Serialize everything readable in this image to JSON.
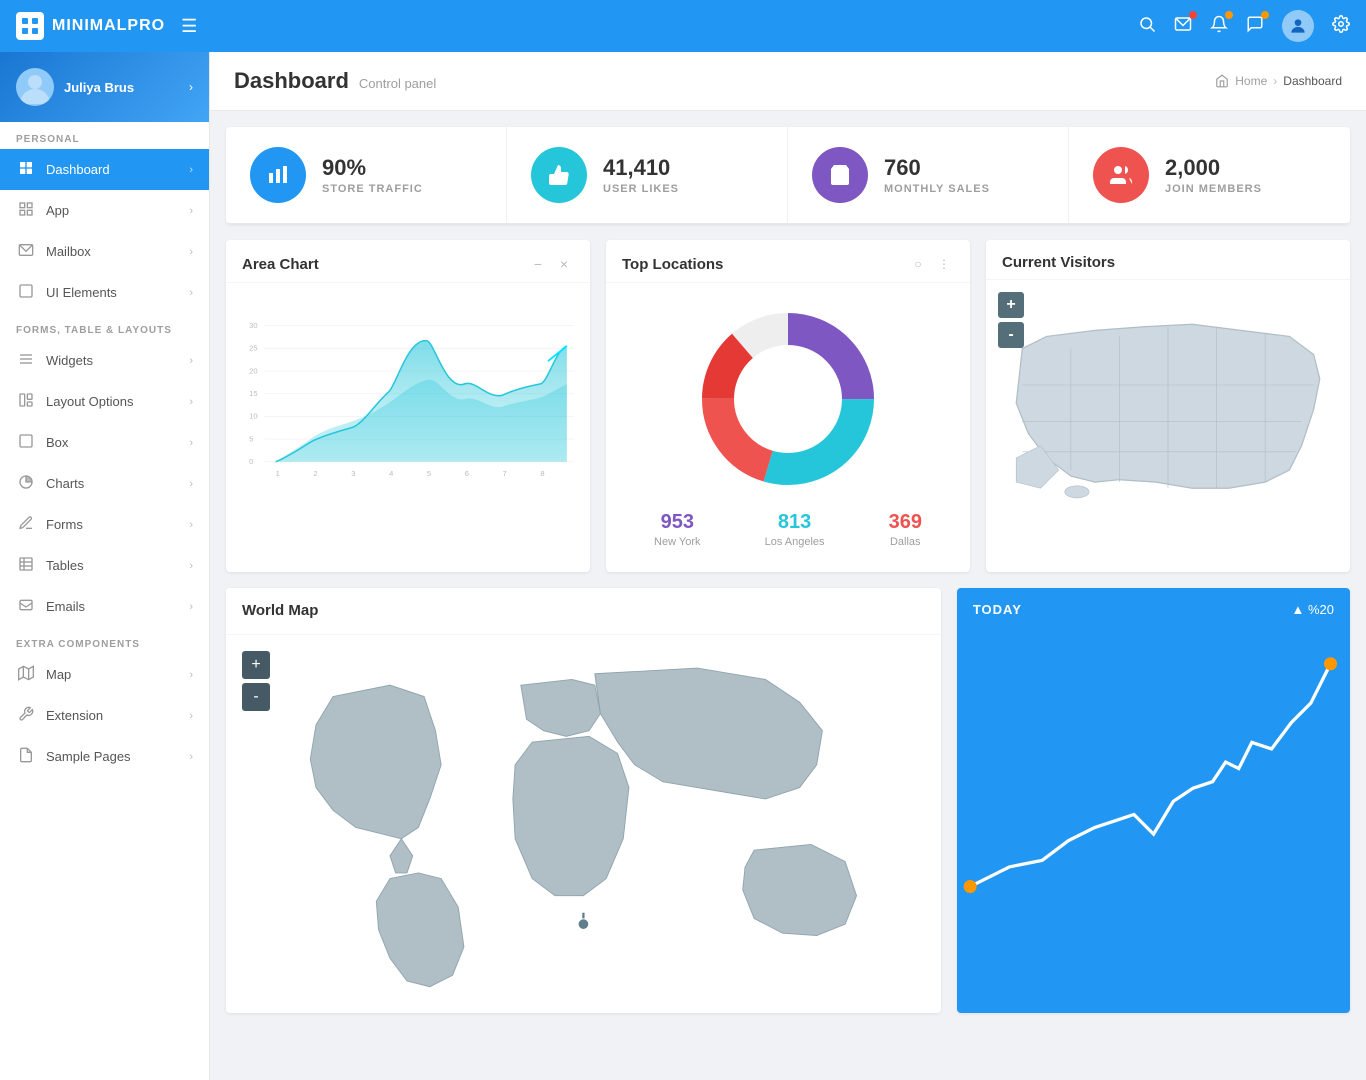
{
  "app": {
    "name": "MINIMALPRO"
  },
  "topnav": {
    "hamburger": "☰"
  },
  "sidebar": {
    "user": {
      "name": "Juliya Brus"
    },
    "sections": [
      {
        "label": "PERSONAL",
        "items": [
          {
            "id": "dashboard",
            "label": "Dashboard",
            "icon": "▦",
            "active": true
          },
          {
            "id": "app",
            "label": "App",
            "icon": "⊞"
          },
          {
            "id": "mailbox",
            "label": "Mailbox",
            "icon": "✉"
          },
          {
            "id": "ui-elements",
            "label": "UI Elements",
            "icon": "□"
          }
        ]
      },
      {
        "label": "FORMS, TABLE & LAYOUTS",
        "items": [
          {
            "id": "widgets",
            "label": "Widgets",
            "icon": "≡"
          },
          {
            "id": "layout-options",
            "label": "Layout Options",
            "icon": "⧉"
          },
          {
            "id": "box",
            "label": "Box",
            "icon": "▢"
          },
          {
            "id": "charts",
            "label": "Charts",
            "icon": "◔"
          },
          {
            "id": "forms",
            "label": "Forms",
            "icon": "✎"
          },
          {
            "id": "tables",
            "label": "Tables",
            "icon": "⊞"
          },
          {
            "id": "emails",
            "label": "Emails",
            "icon": "⌂"
          }
        ]
      },
      {
        "label": "EXTRA COMPONENTS",
        "items": [
          {
            "id": "map",
            "label": "Map",
            "icon": "⊡"
          },
          {
            "id": "extension",
            "label": "Extension",
            "icon": "🔧"
          },
          {
            "id": "sample-pages",
            "label": "Sample Pages",
            "icon": "📄"
          }
        ]
      }
    ]
  },
  "header": {
    "title": "Dashboard",
    "subtitle": "Control panel",
    "breadcrumb": {
      "home": "Home",
      "current": "Dashboard"
    }
  },
  "stats": [
    {
      "id": "store-traffic",
      "value": "90%",
      "label": "STORE TRAFFIC",
      "color": "blue"
    },
    {
      "id": "user-likes",
      "value": "41,410",
      "label": "USER LIKES",
      "color": "teal"
    },
    {
      "id": "monthly-sales",
      "value": "760",
      "label": "MONTHLY SALES",
      "color": "purple"
    },
    {
      "id": "join-members",
      "value": "2,000",
      "label": "JOIN MEMBERS",
      "color": "pink"
    }
  ],
  "area_chart": {
    "title": "Area Chart",
    "y_labels": [
      "30",
      "25",
      "20",
      "15",
      "10",
      "5",
      "0"
    ],
    "x_labels": [
      "1",
      "2",
      "3",
      "4",
      "5",
      "6",
      "7",
      "8"
    ]
  },
  "top_locations": {
    "title": "Top Locations",
    "stats": [
      {
        "value": "953",
        "label": "New York",
        "color": "purple-val"
      },
      {
        "value": "813",
        "label": "Los Angeles",
        "color": "teal-val"
      },
      {
        "value": "369",
        "label": "Dallas",
        "color": "pink-val"
      }
    ]
  },
  "current_visitors": {
    "title": "Current Visitors",
    "zoom_plus": "+",
    "zoom_minus": "-"
  },
  "world_map": {
    "title": "World Map",
    "zoom_plus": "+",
    "zoom_minus": "-"
  },
  "today_card": {
    "label": "TODAY",
    "pct": "▲ %20"
  }
}
